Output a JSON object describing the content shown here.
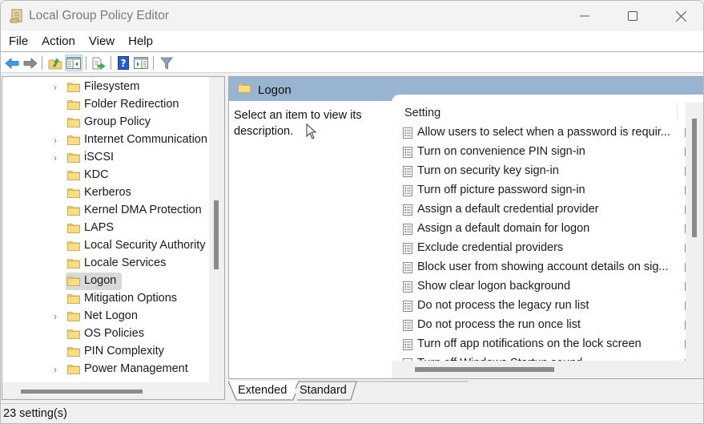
{
  "window": {
    "title": "Local Group Policy Editor"
  },
  "menu": [
    "File",
    "Action",
    "View",
    "Help"
  ],
  "toolbar": {
    "buttons": [
      "back",
      "forward",
      "up-one-level",
      "show-hide-console-tree",
      "export-list",
      "help",
      "show-hide-action-pane",
      "filter"
    ]
  },
  "tree": {
    "items": [
      {
        "label": "Filesystem",
        "expandable": true
      },
      {
        "label": "Folder Redirection",
        "expandable": false
      },
      {
        "label": "Group Policy",
        "expandable": false
      },
      {
        "label": "Internet Communication Management",
        "expandable": true
      },
      {
        "label": "iSCSI",
        "expandable": true
      },
      {
        "label": "KDC",
        "expandable": false
      },
      {
        "label": "Kerberos",
        "expandable": false
      },
      {
        "label": "Kernel DMA Protection",
        "expandable": false
      },
      {
        "label": "LAPS",
        "expandable": false
      },
      {
        "label": "Local Security Authority",
        "expandable": false
      },
      {
        "label": "Locale Services",
        "expandable": false
      },
      {
        "label": "Logon",
        "expandable": false,
        "selected": true
      },
      {
        "label": "Mitigation Options",
        "expandable": false
      },
      {
        "label": "Net Logon",
        "expandable": true
      },
      {
        "label": "OS Policies",
        "expandable": false
      },
      {
        "label": "PIN Complexity",
        "expandable": false
      },
      {
        "label": "Power Management",
        "expandable": true
      }
    ]
  },
  "details": {
    "header": "Logon",
    "description": "Select an item to view its description.",
    "column_setting": "Setting",
    "settings": [
      "Allow users to select when a password is requir...",
      "Turn on convenience PIN sign-in",
      "Turn on security key sign-in",
      "Turn off picture password sign-in",
      "Assign a default credential provider",
      "Assign a default domain for logon",
      "Exclude credential providers",
      "Block user from showing account details on sig...",
      "Show clear logon background",
      "Do not process the legacy run list",
      "Do not process the run once list",
      "Turn off app notifications on the lock screen",
      "Turn off Windows Startup sound"
    ]
  },
  "tabs": {
    "extended": "Extended",
    "standard": "Standard",
    "active": "Extended"
  },
  "status": {
    "text": "23 setting(s)"
  },
  "colors": {
    "pane_header": "#99b4d1",
    "folder": "#f2d27a",
    "selection": "#d9d9d9"
  }
}
